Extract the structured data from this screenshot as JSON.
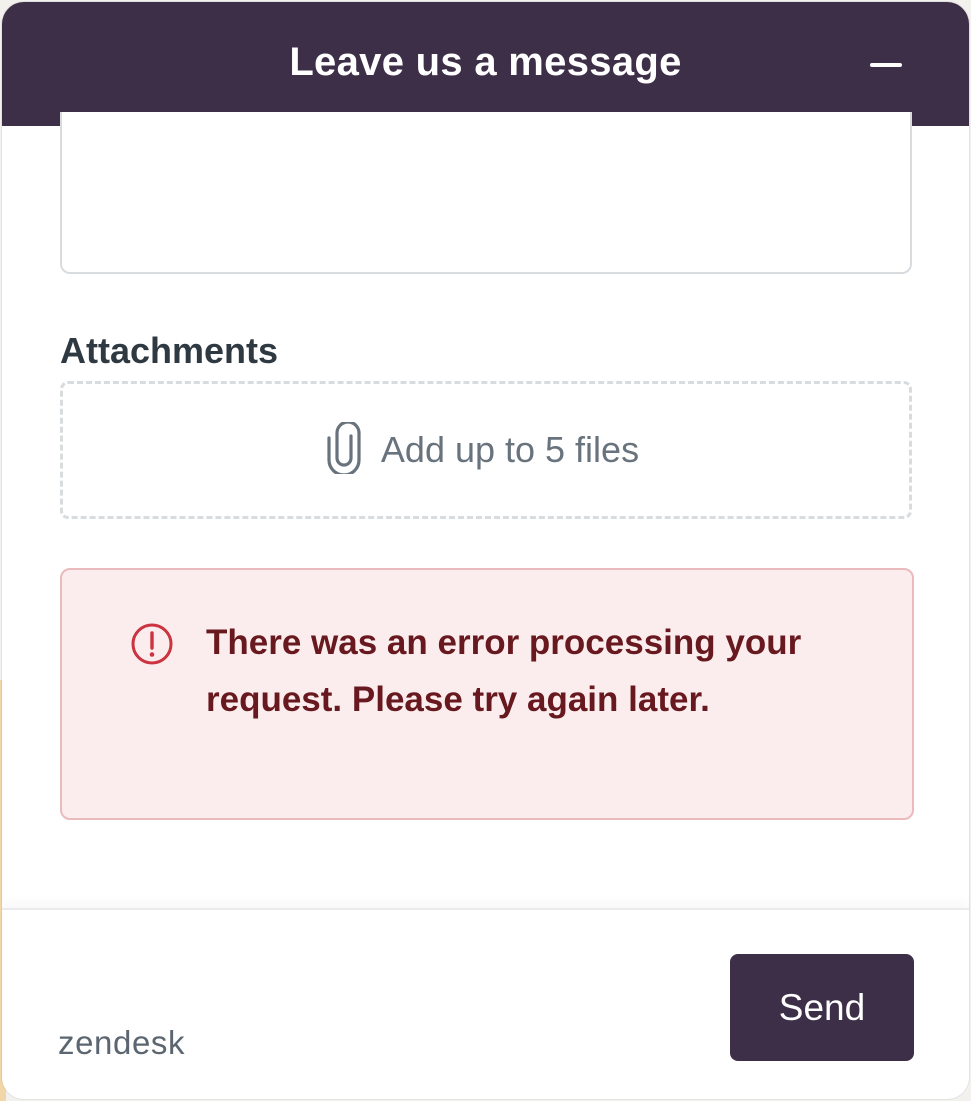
{
  "header": {
    "title": "Leave us a message",
    "minimize_icon": "minus-icon"
  },
  "form": {
    "message_value": "",
    "attachments": {
      "label": "Attachments",
      "dropzone_text": "Add up to 5 files",
      "dropzone_icon": "paperclip-icon"
    },
    "error": {
      "icon": "alert-circle-icon",
      "message": "There was an error processing your request. Please try again later."
    }
  },
  "footer": {
    "branding": "zendesk",
    "send_label": "Send"
  },
  "colors": {
    "brand": "#3d2f47",
    "error_text": "#68191f",
    "error_bg": "#fbeded",
    "error_border": "#ebbabd",
    "error_icon": "#cc3340"
  }
}
